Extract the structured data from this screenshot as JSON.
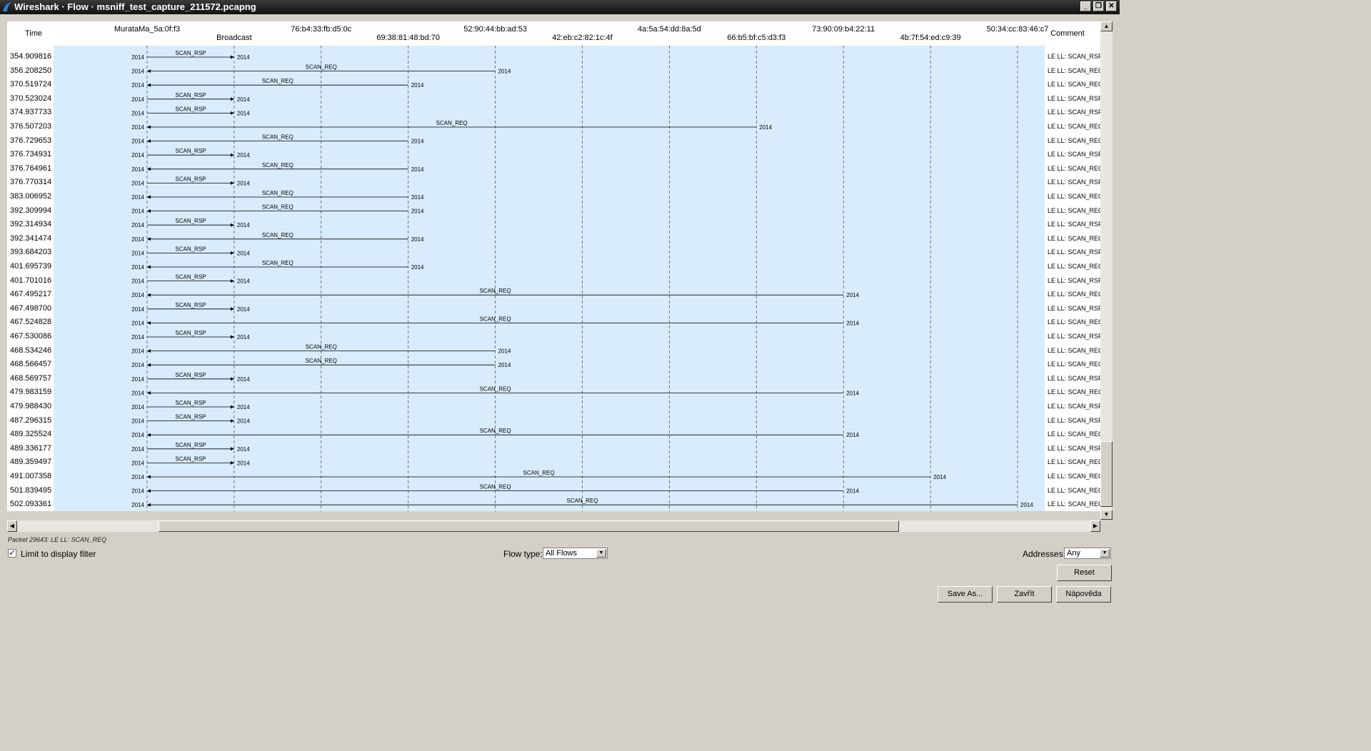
{
  "window": {
    "title": "Wireshark · Flow · msniff_test_capture_211572.pcapng"
  },
  "columns": {
    "time": "Time",
    "comment": "Comment"
  },
  "nodes": [
    {
      "label": "MurataMa_5a:0f:f3",
      "row": 0
    },
    {
      "label": "Broadcast",
      "row": 1
    },
    {
      "label": "76:b4:33:fb:d5:0c",
      "row": 0
    },
    {
      "label": "69:38:81:48:bd:70",
      "row": 1
    },
    {
      "label": "52:90:44:bb:ad:53",
      "row": 0
    },
    {
      "label": "42:eb:c2:82:1c:4f",
      "row": 1
    },
    {
      "label": "4a:5a:54:dd:8a:5d",
      "row": 0
    },
    {
      "label": "66:b5:bf:c5:d3:f3",
      "row": 1
    },
    {
      "label": "73:90:09:b4:22:11",
      "row": 0
    },
    {
      "label": "4b:7f:54:ed:c9:39",
      "row": 1
    },
    {
      "label": "50:34:cc:83:46:c7",
      "row": 0
    }
  ],
  "flows": [
    {
      "time": "354.909816",
      "label": "SCAN_RSP",
      "from": 0,
      "to": 1,
      "port_from": "2014",
      "port_to": "2014",
      "comment": "LE LL: SCAN_RSP"
    },
    {
      "time": "356.208250",
      "label": "SCAN_REQ",
      "from": 4,
      "to": 0,
      "port_from": "2014",
      "port_to": "2014",
      "comment": "LE LL: SCAN_REQ"
    },
    {
      "time": "370.519724",
      "label": "SCAN_REQ",
      "from": 3,
      "to": 0,
      "port_from": "2014",
      "port_to": "2014",
      "comment": "LE LL: SCAN_REQ"
    },
    {
      "time": "370.523024",
      "label": "SCAN_RSP",
      "from": 0,
      "to": 1,
      "port_from": "2014",
      "port_to": "2014",
      "comment": "LE LL: SCAN_RSP"
    },
    {
      "time": "374.937733",
      "label": "SCAN_RSP",
      "from": 0,
      "to": 1,
      "port_from": "2014",
      "port_to": "2014",
      "comment": "LE LL: SCAN_RSP"
    },
    {
      "time": "376.507203",
      "label": "SCAN_REQ",
      "from": 7,
      "to": 0,
      "port_from": "2014",
      "port_to": "2014",
      "comment": "LE LL: SCAN_REQ"
    },
    {
      "time": "376.729653",
      "label": "SCAN_REQ",
      "from": 3,
      "to": 0,
      "port_from": "2014",
      "port_to": "2014",
      "comment": "LE LL: SCAN_REQ"
    },
    {
      "time": "376.734931",
      "label": "SCAN_RSP",
      "from": 0,
      "to": 1,
      "port_from": "2014",
      "port_to": "2014",
      "comment": "LE LL: SCAN_RSP"
    },
    {
      "time": "376.764961",
      "label": "SCAN_REQ",
      "from": 3,
      "to": 0,
      "port_from": "2014",
      "port_to": "2014",
      "comment": "LE LL: SCAN_REQ"
    },
    {
      "time": "376.770314",
      "label": "SCAN_RSP",
      "from": 0,
      "to": 1,
      "port_from": "2014",
      "port_to": "2014",
      "comment": "LE LL: SCAN_RSP"
    },
    {
      "time": "383.006952",
      "label": "SCAN_REQ",
      "from": 3,
      "to": 0,
      "port_from": "2014",
      "port_to": "2014",
      "comment": "LE LL: SCAN_REQ"
    },
    {
      "time": "392.309994",
      "label": "SCAN_REQ",
      "from": 3,
      "to": 0,
      "port_from": "2014",
      "port_to": "2014",
      "comment": "LE LL: SCAN_REQ"
    },
    {
      "time": "392.314934",
      "label": "SCAN_RSP",
      "from": 0,
      "to": 1,
      "port_from": "2014",
      "port_to": "2014",
      "comment": "LE LL: SCAN_RSP"
    },
    {
      "time": "392.341474",
      "label": "SCAN_REQ",
      "from": 3,
      "to": 0,
      "port_from": "2014",
      "port_to": "2014",
      "comment": "LE LL: SCAN_REQ"
    },
    {
      "time": "393.684203",
      "label": "SCAN_RSP",
      "from": 0,
      "to": 1,
      "port_from": "2014",
      "port_to": "2014",
      "comment": "LE LL: SCAN_RSP"
    },
    {
      "time": "401.695739",
      "label": "SCAN_REQ",
      "from": 3,
      "to": 0,
      "port_from": "2014",
      "port_to": "2014",
      "comment": "LE LL: SCAN_REQ"
    },
    {
      "time": "401.701016",
      "label": "SCAN_RSP",
      "from": 0,
      "to": 1,
      "port_from": "2014",
      "port_to": "2014",
      "comment": "LE LL: SCAN_RSP"
    },
    {
      "time": "467.495217",
      "label": "SCAN_REQ",
      "from": 8,
      "to": 0,
      "port_from": "2014",
      "port_to": "2014",
      "comment": "LE LL: SCAN_REQ"
    },
    {
      "time": "467.498700",
      "label": "SCAN_RSP",
      "from": 0,
      "to": 1,
      "port_from": "2014",
      "port_to": "2014",
      "comment": "LE LL: SCAN_RSP"
    },
    {
      "time": "467.524828",
      "label": "SCAN_REQ",
      "from": 8,
      "to": 0,
      "port_from": "2014",
      "port_to": "2014",
      "comment": "LE LL: SCAN_REQ"
    },
    {
      "time": "467.530086",
      "label": "SCAN_RSP",
      "from": 0,
      "to": 1,
      "port_from": "2014",
      "port_to": "2014",
      "comment": "LE LL: SCAN_RSP"
    },
    {
      "time": "468.534246",
      "label": "SCAN_REQ",
      "from": 4,
      "to": 0,
      "port_from": "2014",
      "port_to": "2014",
      "comment": "LE LL: SCAN_REQ"
    },
    {
      "time": "468.566457",
      "label": "SCAN_REQ",
      "from": 4,
      "to": 0,
      "port_from": "2014",
      "port_to": "2014",
      "comment": "LE LL: SCAN_REQ"
    },
    {
      "time": "468.569757",
      "label": "SCAN_RSP",
      "from": 0,
      "to": 1,
      "port_from": "2014",
      "port_to": "2014",
      "comment": "LE LL: SCAN_RSP"
    },
    {
      "time": "479.983159",
      "label": "SCAN_REQ",
      "from": 8,
      "to": 0,
      "port_from": "2014",
      "port_to": "2014",
      "comment": "LE LL: SCAN_REQ"
    },
    {
      "time": "479.988430",
      "label": "SCAN_RSP",
      "from": 0,
      "to": 1,
      "port_from": "2014",
      "port_to": "2014",
      "comment": "LE LL: SCAN_RSP"
    },
    {
      "time": "487.296315",
      "label": "SCAN_RSP",
      "from": 0,
      "to": 1,
      "port_from": "2014",
      "port_to": "2014",
      "comment": "LE LL: SCAN_RSP"
    },
    {
      "time": "489.325524",
      "label": "SCAN_REQ",
      "from": 8,
      "to": 0,
      "port_from": "2014",
      "port_to": "2014",
      "comment": "LE LL: SCAN_REQ"
    },
    {
      "time": "489.336177",
      "label": "SCAN_RSP",
      "from": 0,
      "to": 1,
      "port_from": "2014",
      "port_to": "2014",
      "comment": "LE LL: SCAN_RSP"
    },
    {
      "time": "489.359497",
      "label": "SCAN_RSP",
      "from": 0,
      "to": 1,
      "port_from": "2014",
      "port_to": "2014",
      "comment": "LE LL: SCAN_REQ"
    },
    {
      "time": "491.007358",
      "label": "SCAN_REQ",
      "from": 9,
      "to": 0,
      "port_from": "2014",
      "port_to": "2014",
      "comment": "LE LL: SCAN_REQ"
    },
    {
      "time": "501.839495",
      "label": "SCAN_REQ",
      "from": 8,
      "to": 0,
      "port_from": "2014",
      "port_to": "2014",
      "comment": "LE LL: SCAN_REQ"
    },
    {
      "time": "502.093361",
      "label": "SCAN_REQ",
      "from": 10,
      "to": 0,
      "port_from": "2014",
      "port_to": "2014",
      "comment": "LE LL: SCAN_REQ"
    }
  ],
  "status": "Packet 29643: LE LL: SCAN_REQ",
  "controls": {
    "limit_label": "Limit to display filter",
    "limit_checked": true,
    "flow_type_label": "Flow type:",
    "flow_type_value": "All Flows",
    "addresses_label": "Addresses:",
    "addresses_value": "Any",
    "reset": "Reset",
    "save_as": "Save As...",
    "close": "Zavřít",
    "help": "Nápověda"
  },
  "colors": {
    "diagram_bg": "#d9ecfb",
    "titlebar": "#1a1a1a"
  },
  "icons": [
    "wireshark-fin-icon",
    "minimize-icon",
    "restore-icon",
    "close-icon",
    "checkmark-icon",
    "chevron-down-icon",
    "arrow-up-icon",
    "arrow-down-icon",
    "arrow-left-icon",
    "arrow-right-icon"
  ]
}
